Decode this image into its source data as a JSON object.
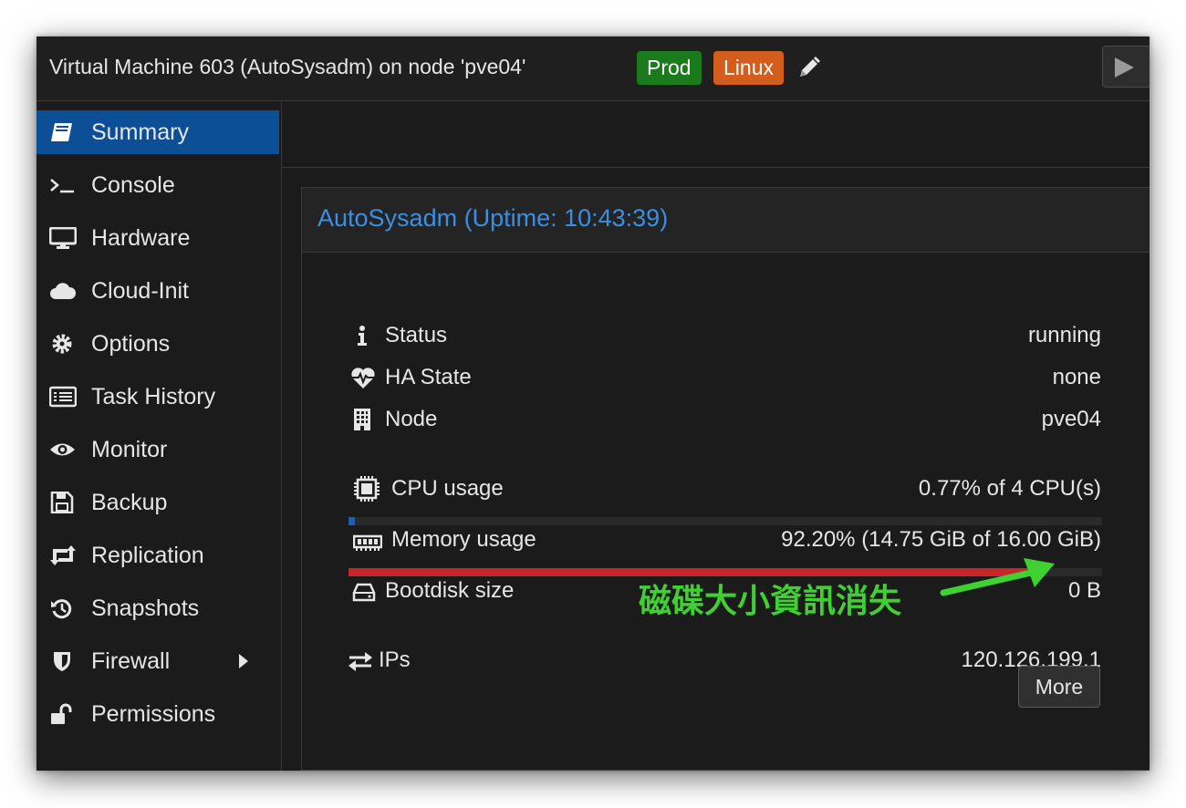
{
  "window": {
    "title": "Virtual Machine 603 (AutoSysadm) on node 'pve04'",
    "tags": [
      {
        "label": "Prod",
        "color": "#1b7a1b"
      },
      {
        "label": "Linux",
        "color": "#d35d1c"
      }
    ]
  },
  "sidebar": {
    "items": [
      {
        "label": "Summary",
        "icon": "book-icon",
        "active": true
      },
      {
        "label": "Console",
        "icon": "terminal-icon"
      },
      {
        "label": "Hardware",
        "icon": "desktop-icon"
      },
      {
        "label": "Cloud-Init",
        "icon": "cloud-icon"
      },
      {
        "label": "Options",
        "icon": "gear-icon"
      },
      {
        "label": "Task History",
        "icon": "list-icon"
      },
      {
        "label": "Monitor",
        "icon": "eye-icon"
      },
      {
        "label": "Backup",
        "icon": "floppy-icon"
      },
      {
        "label": "Replication",
        "icon": "retweet-icon"
      },
      {
        "label": "Snapshots",
        "icon": "history-icon"
      },
      {
        "label": "Firewall",
        "icon": "shield-icon",
        "has_submenu": true
      },
      {
        "label": "Permissions",
        "icon": "unlock-icon"
      }
    ]
  },
  "summary": {
    "title": "AutoSysadm (Uptime: 10:43:39)",
    "status": {
      "label": "Status",
      "value": "running"
    },
    "ha_state": {
      "label": "HA State",
      "value": "none"
    },
    "node": {
      "label": "Node",
      "value": "pve04"
    },
    "cpu": {
      "label": "CPU usage",
      "value": "0.77% of 4 CPU(s)",
      "percent": 0.77,
      "bar_color": "#1f5fb0"
    },
    "memory": {
      "label": "Memory usage",
      "value": "92.20% (14.75 GiB of 16.00 GiB)",
      "percent": 92.2,
      "bar_color": "#c9262b"
    },
    "bootdisk": {
      "label": "Bootdisk size",
      "value": "0 B"
    },
    "ips": {
      "label": "IPs",
      "value": "120.126.199.1",
      "more_label": "More"
    }
  },
  "annotation": {
    "text": "磁碟大小資訊消失",
    "color": "#3fd132"
  },
  "colors": {
    "accent": "#0c4f97",
    "title_link": "#3a8ee6",
    "background": "#1b1b1b"
  }
}
